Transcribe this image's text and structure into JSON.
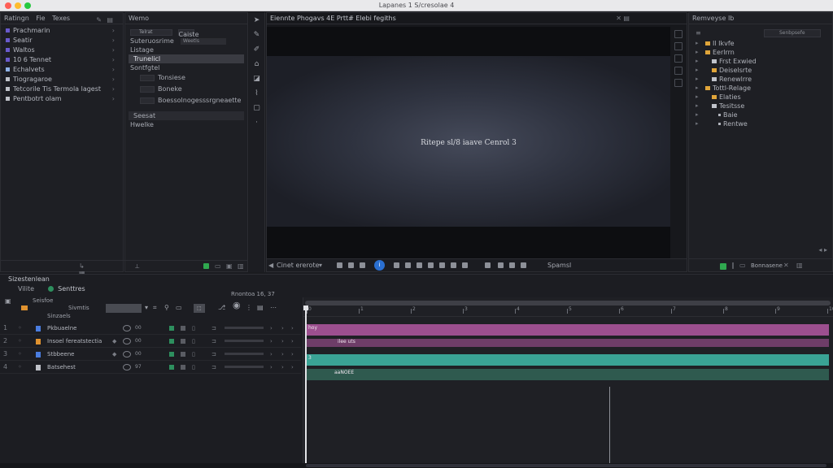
{
  "window": {
    "title": "Lapanes 1 S/cresolae 4"
  },
  "project": {
    "tabs": [
      "Ratingn",
      "Fie",
      "Texes"
    ],
    "items": [
      {
        "label": "Prachmarin",
        "color": "#6a5acd"
      },
      {
        "label": "Seatir",
        "color": "#6a5acd"
      },
      {
        "label": "Waltos",
        "color": "#6a5acd"
      },
      {
        "label": "10 6 Tennet",
        "color": "#6a5acd"
      },
      {
        "label": "Echalvets",
        "color": "#8fb2e8"
      },
      {
        "label": "Tiogragaroe",
        "color": "#c0c3ca"
      },
      {
        "label": "Tetcorile Tis Termola lagest",
        "color": "#c0c3ca"
      },
      {
        "label": "Pentbotrt olam",
        "color": "#c0c3ca"
      }
    ]
  },
  "effects": {
    "title": "Wemo",
    "search_value": "Telrat",
    "toggle_label": "Caiste",
    "rows": [
      {
        "label": "Suteruosrime",
        "kind": "plain",
        "pill": "Weetls"
      },
      {
        "label": "Listage",
        "kind": "plain"
      },
      {
        "label": "Trunelicl",
        "kind": "selected"
      },
      {
        "label": "Sontfgtel",
        "kind": "plain"
      }
    ],
    "params": [
      {
        "label": "Tonsiese"
      },
      {
        "label": "Boneke"
      },
      {
        "label": "Boessolnogesssrgneaette"
      }
    ],
    "group_label": "Seesat",
    "group_sub": "Hwelke"
  },
  "viewer": {
    "title": "Eiennte Phogavs 4E Prtt# Elebi fegiths",
    "canvas_text": "Ritepe sl/8 iaave Cenrol 3",
    "zoom_label": "Cinet ererote",
    "fit_label": "Spamsl"
  },
  "layers": {
    "title": "Remveyse Ib",
    "search_placeholder": "Senbpsefe",
    "tree": [
      {
        "label": "Il Ikvfe",
        "depth": 0,
        "kind": "folder"
      },
      {
        "label": "Eerlrrn",
        "depth": 0,
        "kind": "folder"
      },
      {
        "label": "Frst Exwied",
        "depth": 1,
        "kind": "plain"
      },
      {
        "label": "Deiselsrte",
        "depth": 1,
        "kind": "folder"
      },
      {
        "label": "Renewlrre",
        "depth": 1,
        "kind": "plain"
      },
      {
        "label": "Tottl-Relage",
        "depth": 0,
        "kind": "folder"
      },
      {
        "label": "Elaties",
        "depth": 1,
        "kind": "folder"
      },
      {
        "label": "Tesitsse",
        "depth": 1,
        "kind": "plain"
      },
      {
        "label": "Baie",
        "depth": 2,
        "kind": "dot"
      },
      {
        "label": "Rentwe",
        "depth": 2,
        "kind": "dot"
      }
    ],
    "footer_label": "Bonnasene"
  },
  "timeline": {
    "title": "Sizestenlean",
    "tabs": [
      "Vilite",
      "Senttres"
    ],
    "timecode": "Rnontoa 16, 37",
    "search_label": "Sivmtis",
    "layer_header": "Seisfoe",
    "sub_header": "Sinzaels",
    "layers": [
      {
        "num": "1",
        "name": "Pkbuaelne",
        "icon_color": "#4a7de0",
        "pv": "00",
        "swatch": "#2d8f5e"
      },
      {
        "num": "2",
        "name": "Insoel fereatstectia",
        "icon_color": "#e0922f",
        "pv": "00",
        "swatch": "#2d8f5e"
      },
      {
        "num": "3",
        "name": "Stbbeene",
        "icon_color": "#4a7de0",
        "pv": "00",
        "swatch": "#2d8f5e"
      },
      {
        "num": "4",
        "name": "Batsehest",
        "icon_color": "#c0c3ca",
        "pv": "97",
        "swatch": "#2d8f5e"
      }
    ],
    "ruler_labels": [
      "0",
      "1",
      "2",
      "3",
      "4",
      "5",
      "6",
      "7",
      "8",
      "9",
      "10"
    ],
    "tracks": [
      {
        "label": "hoy",
        "color": "#9c4f8f",
        "fraction_start": 0.0,
        "fraction_end": 1.0
      },
      {
        "label": "ilee uts",
        "color": "#6e3d68",
        "fraction_start": 0.0,
        "fraction_end": 1.0
      },
      {
        "label": "3",
        "color": "#3aa395",
        "fraction_start": 0.0,
        "fraction_end": 1.0
      },
      {
        "label": "aaNOEE",
        "color": "#2f5a4f",
        "fraction_start": 0.0,
        "fraction_end": 1.0
      }
    ]
  }
}
